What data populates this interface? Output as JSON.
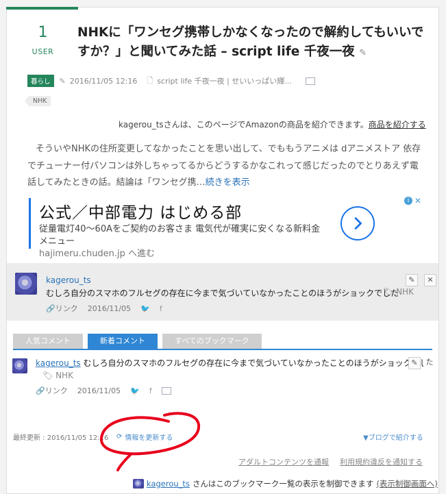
{
  "entry": {
    "user_count": "1",
    "user_label": "USER",
    "title": "NHKに「ワンセグ携帯しかなくなったので解約してもいいですか？」と聞いてみた話 – script life 千夜一夜",
    "category": "暮らし",
    "date": "2016/11/05 12:16",
    "source": "script life 千夜一夜 | せいいっぱい輝...",
    "tag": "NHK",
    "amazon_text": "kagerou_tsさんは、このページでAmazonの商品を紹介できます。",
    "amazon_link": "商品を紹介する",
    "summary": "そういやNHKの住所変更してなかったことを思い出して、でももうアニメは dアニメストア 依存でチューナー付パソコンは外しちゃってるからどうするかなこれって感じだったのでとりあえず電話してみたときの話。結論は「ワンセグ携…",
    "read_more": "続きを表示"
  },
  "ad": {
    "headline": "公式／中部電力 はじめる部",
    "desc": "従量電灯40～60Aをご契約のお客さま 電気代が確実に安くなる新料金メニュー",
    "url": "hajimeru.chuden.jp へ進む"
  },
  "my_bookmark": {
    "user": "kagerou_ts",
    "comment": "むしろ自分のスマホのフルセグの存在に今まで気づいていなかったことのほうがショックでした",
    "tag": "NHK",
    "link_label": "リンク",
    "date": "2016/11/05"
  },
  "tabs": [
    "人気コメント",
    "新着コメント",
    "すべてのブックマーク"
  ],
  "list_entry": {
    "user": "kagerou_ts",
    "comment": "むしろ自分のスマホのフルセグの存在に今まで気づいていなかったことのほうがショックでした",
    "tag": "NHK",
    "link_label": "リンク",
    "date": "2016/11/05"
  },
  "footer": {
    "last_updated": "最終更新 : 2016/11/05 12:16",
    "refresh": "情報を更新する",
    "blog_intro": "▼ブログで紹介する",
    "adult_report": "アダルトコンテンツを通報",
    "tos_report": "利用規約違反を通知する",
    "control_user": "kagerou_ts",
    "control_text": "さんはこのブックマーク一覧の表示を制御できます",
    "control_link": "(表示制御画面へ)"
  },
  "colors": {
    "accent": "#25865c",
    "tab_active": "#2f86d4",
    "annotation": "#e8001c"
  }
}
